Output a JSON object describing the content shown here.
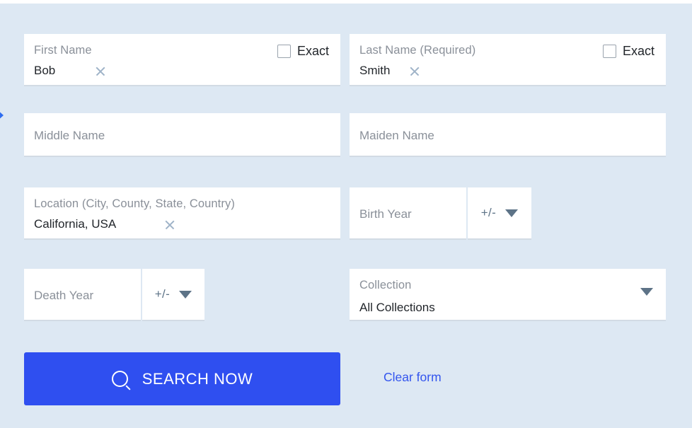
{
  "page": {
    "background_color": "#dde8f3",
    "accent_color": "#2f4ff0",
    "link_color": "#3355ee"
  },
  "form": {
    "fields": {
      "first_name": {
        "label": "First Name",
        "value": "Bob",
        "clear_icon": "close-icon",
        "exact_label": "Exact",
        "exact_checked": false
      },
      "last_name": {
        "label": "Last Name (Required)",
        "value": "Smith",
        "clear_icon": "close-icon",
        "exact_label": "Exact",
        "exact_checked": false
      },
      "middle_name": {
        "placeholder": "Middle Name",
        "value": ""
      },
      "maiden_name": {
        "placeholder": "Maiden Name",
        "value": ""
      },
      "location": {
        "label": "Location (City, County, State, Country)",
        "value": "California, USA",
        "clear_icon": "close-icon"
      },
      "birth_year": {
        "placeholder": "Birth Year",
        "value": "",
        "range_label": "+/-",
        "range_icon": "chevron-down-icon"
      },
      "death_year": {
        "placeholder": "Death Year",
        "value": "",
        "range_label": "+/-",
        "range_icon": "chevron-down-icon"
      },
      "collection": {
        "label": "Collection",
        "value": "All Collections",
        "dropdown_icon": "chevron-down-icon"
      }
    },
    "actions": {
      "search_label": "SEARCH NOW",
      "search_icon": "search-icon",
      "clear_form_label": "Clear form"
    }
  }
}
